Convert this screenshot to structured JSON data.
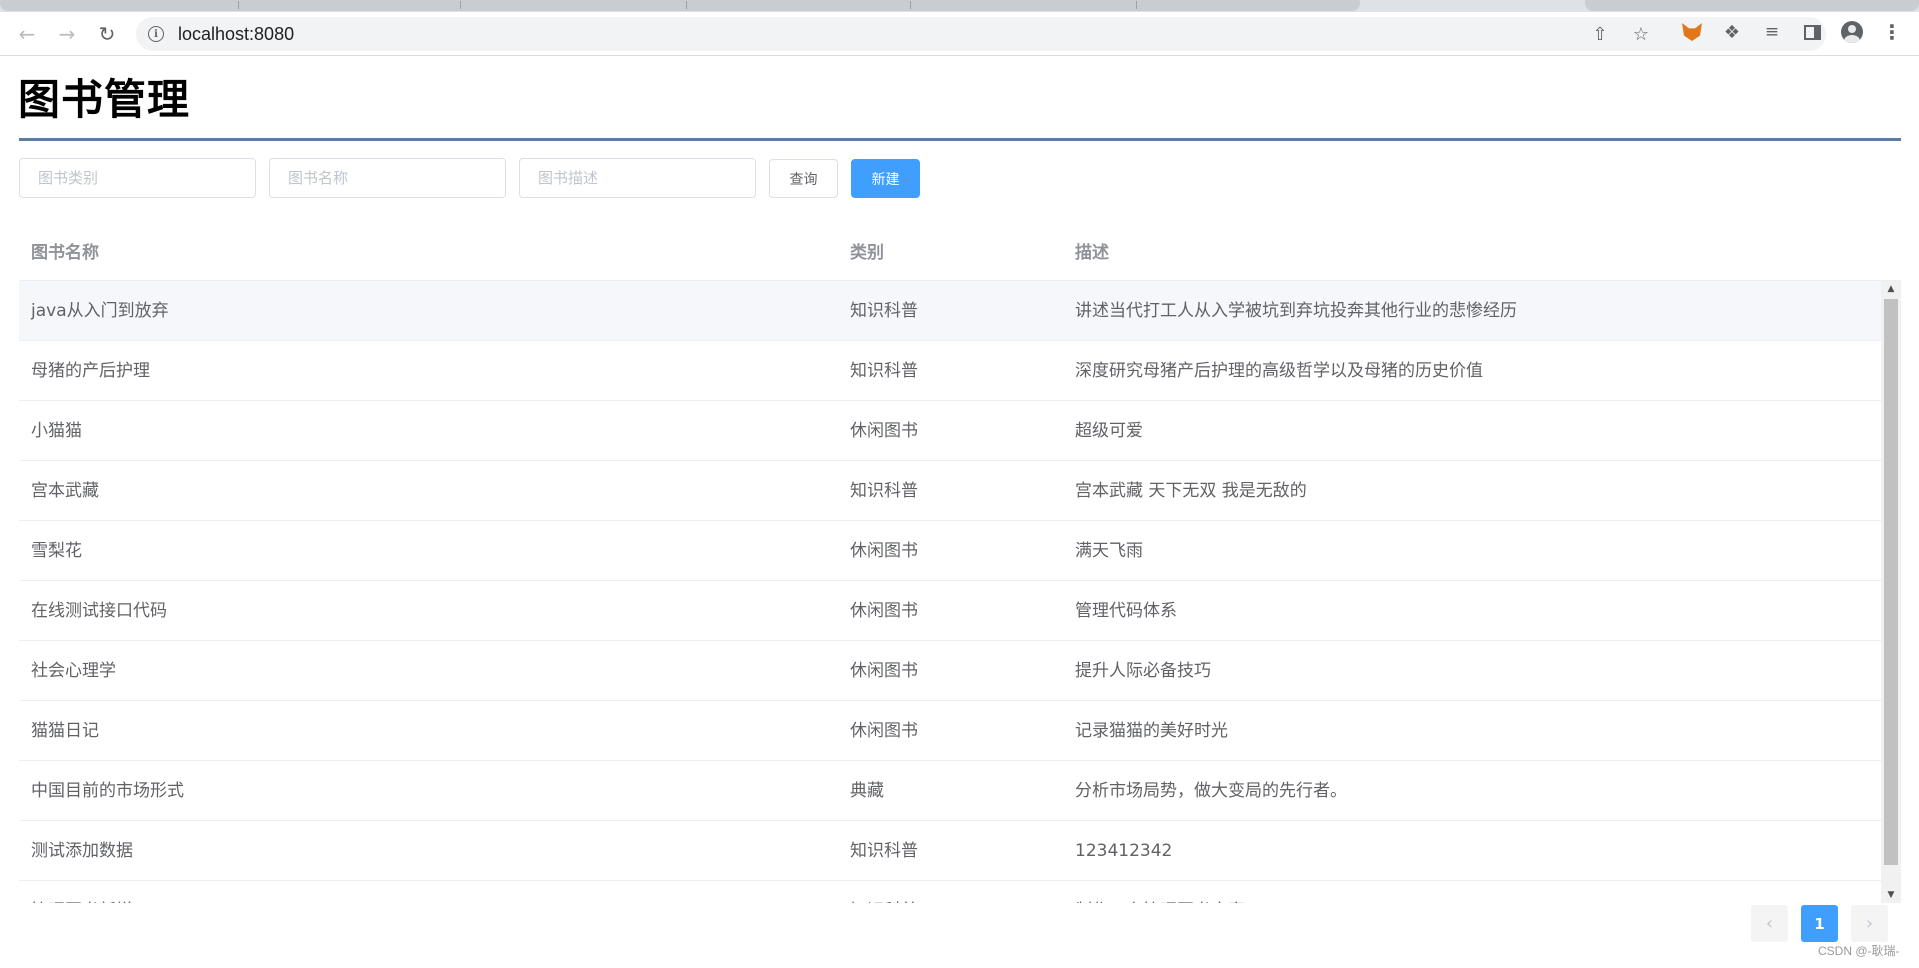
{
  "browser": {
    "url": "localhost:8080",
    "icons": {
      "back": "arrow-left-icon",
      "forward": "arrow-right-icon",
      "reload": "reload-icon",
      "info": "site-info-icon",
      "share": "share-icon",
      "bookmark": "star-icon",
      "metamask": "fox-extension-icon",
      "extensions": "puzzle-icon",
      "media": "media-queue-icon",
      "sidepanel": "side-panel-icon",
      "profile": "profile-avatar-icon",
      "menu": "kebab-menu-icon"
    }
  },
  "page": {
    "title": "图书管理"
  },
  "search": {
    "category_placeholder": "图书类别",
    "name_placeholder": "图书名称",
    "desc_placeholder": "图书描述",
    "query_label": "查询",
    "create_label": "新建"
  },
  "table": {
    "headers": [
      "图书名称",
      "类别",
      "描述"
    ],
    "rows": [
      {
        "name": "java从入门到放弃",
        "category": "知识科普",
        "desc": "讲述当代打工人从入学被坑到弃坑投奔其他行业的悲惨经历"
      },
      {
        "name": "母猪的产后护理",
        "category": "知识科普",
        "desc": "深度研究母猪产后护理的高级哲学以及母猪的历史价值"
      },
      {
        "name": "小猫猫",
        "category": "休闲图书",
        "desc": "超级可爱"
      },
      {
        "name": "宫本武藏",
        "category": "知识科普",
        "desc": "宫本武藏 天下无双 我是无敌的"
      },
      {
        "name": "雪梨花",
        "category": "休闲图书",
        "desc": "满天飞雨"
      },
      {
        "name": "在线测试接口代码",
        "category": "休闲图书",
        "desc": "管理代码体系"
      },
      {
        "name": "社会心理学",
        "category": "休闲图书",
        "desc": "提升人际必备技巧"
      },
      {
        "name": "猫猫日记",
        "category": "休闲图书",
        "desc": "记录猫猫的美好时光"
      },
      {
        "name": "中国目前的市场形式",
        "category": "典藏",
        "desc": "分析市场局势，做大变局的先行者。"
      },
      {
        "name": "测试添加数据",
        "category": "知识科普",
        "desc": "123412342"
      },
      {
        "name": "管理图书新增",
        "category": "知识科普",
        "desc": "制作一套管理图书方案"
      }
    ]
  },
  "pagination": {
    "current": "1",
    "prev_symbol": "‹",
    "next_symbol": "›"
  },
  "watermark": "CSDN @-耿瑞-",
  "colors": {
    "primary": "#409eff",
    "title_rule": "#5b7d9f",
    "header_text": "#909399",
    "cell_text": "#606266",
    "row_hover": "#f5f7fa"
  }
}
